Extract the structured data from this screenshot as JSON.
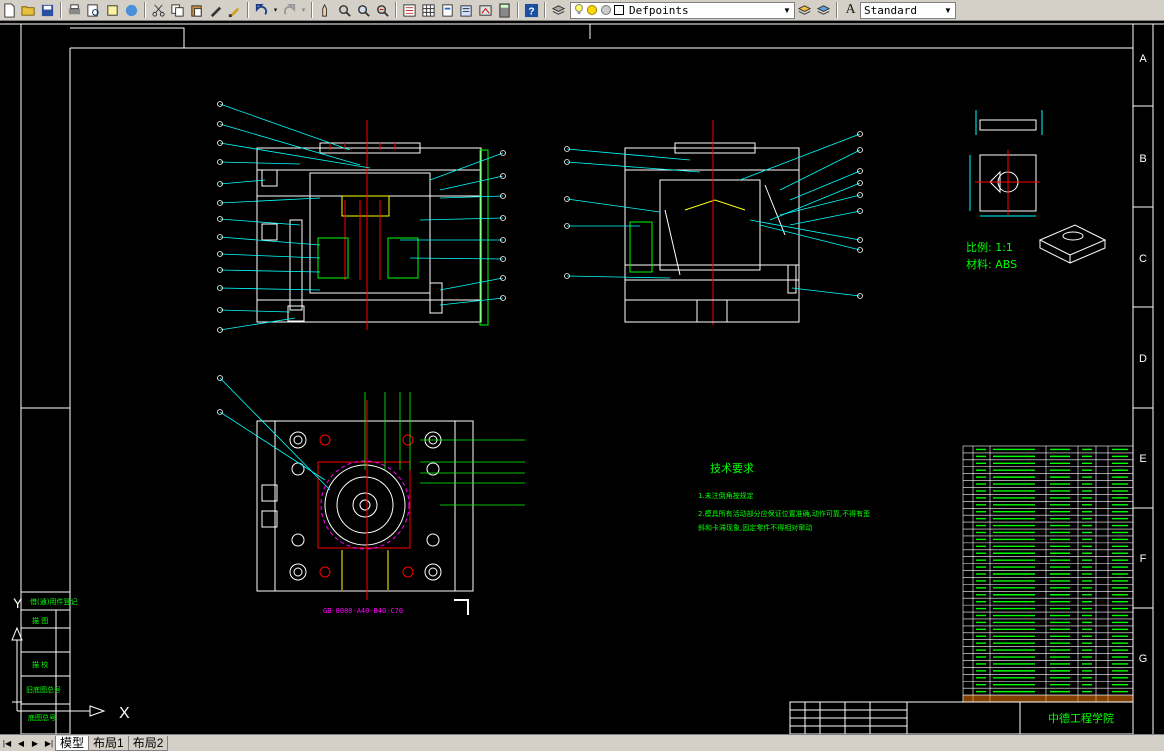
{
  "toolbar": {
    "layer_name": "Defpoints",
    "text_style": "Standard",
    "font_letter": "A",
    "icons": [
      "new-icon",
      "open-icon",
      "save-icon",
      "print-icon",
      "preview-icon",
      "publish-icon",
      "plot-icon",
      "cut-icon",
      "copy-icon",
      "paste-icon",
      "matchprop-icon",
      "brush-icon",
      "undo-icon",
      "redo-icon",
      "pan-icon",
      "zoom-realtime-icon",
      "zoom-window-icon",
      "zoom-previous-icon",
      "properties-icon",
      "design-center-icon",
      "tool-palettes-icon",
      "sheetset-icon",
      "markup-icon",
      "calculator-icon",
      "help-icon",
      "layer-manager-icon",
      "lightbulb-icon",
      "sun-icon",
      "freeze-icon",
      "layer-prev-icon",
      "layer-states-icon",
      "text-style-icon"
    ]
  },
  "tabs": {
    "model": "模型",
    "layout1": "布局1",
    "layout2": "布局2"
  },
  "drawing": {
    "row_labels": [
      "A",
      "B",
      "C",
      "D",
      "E",
      "F",
      "G"
    ],
    "scale_label": "比例: 1:1",
    "material_label": "材料: ABS",
    "tech_title": "技术要求",
    "tech_lines": [
      "1.未注倒角按规定",
      "2.模具所有活动部分应保证位置准确,动作可靠,不得有歪",
      "斜和卡滞现象,固定零件不得相对窜动"
    ],
    "mold_designation": "GB-8080-A40-B40-C70",
    "title_block_school": "中德工程学院",
    "ucs_label": "X",
    "ucs_y": "Y",
    "left_strip_labels": [
      "借(通)用件登记",
      "描 图",
      "描 校",
      "旧底图总号",
      "底图总号"
    ]
  },
  "colors": {
    "background": "#000000",
    "lines": "#ffffff",
    "green": "#00ff00",
    "cyan": "#00ffff",
    "yellow": "#ffff00",
    "magenta": "#ff00ff",
    "red": "#ff0000"
  }
}
